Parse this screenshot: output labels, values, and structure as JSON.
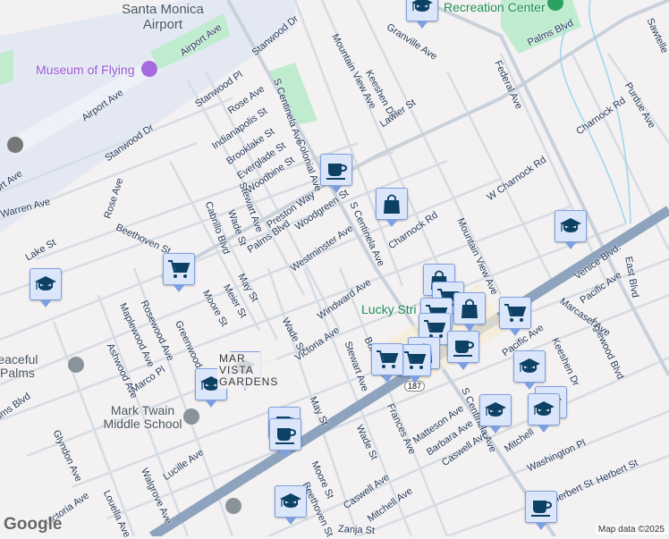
{
  "pois": {
    "airport": "Santa Monica Airport",
    "museum": "Museum of Flying",
    "recreation": "Recreation Center",
    "peaceful_palms": "Peaceful Palms Training Center",
    "mark_twain": "Mark Twain Middle School",
    "lucky_strike": "Lucky Stri",
    "mar_vista": "MAR VISTA GARDENS"
  },
  "streets": [
    "Airport Ave",
    "Airport Ave",
    "ort Ave",
    "Stanwood Dr",
    "Stanwood Pl",
    "Rose Ave",
    "Indianapolis St",
    "Brooklake St",
    "Everglade St",
    "Woodbine St",
    "Preston Way",
    "Stanwood Dr",
    "Warren Ave",
    "Rose Ave",
    "Beethoven St",
    "Lake St",
    "Cabrillo Blvd",
    "Wade St",
    "Stewart Ave",
    "Colonial Ave",
    "S Centinela Ave",
    "Palms Blvd",
    "Woodgreen St",
    "Westminster Ave",
    "Granville Ave",
    "Mountain View Ave",
    "Keeshen Dr",
    "Lawler St",
    "Federal Ave",
    "Palms Blvd",
    "Charnock Rd",
    "Purdue Ave",
    "W Charnock Rd",
    "Charnock Rd",
    "S Centinela Ave",
    "Mountain View Ave",
    "Venice Blvd.",
    "Inglewood Blvd",
    "Pacific Ave",
    "East Blvd",
    "Marcasel Ave",
    "Windward Ave",
    "Moore St",
    "Meier St",
    "May St",
    "Wade St",
    "Victoria Ave",
    "Stewart Ave",
    "Maplewood Ave",
    "Rosewood Ave",
    "Greenwood Ave",
    "Ashwood Ave",
    "Marco Pl",
    "Lucille Ave",
    "Walgrove Ave",
    "Glyndon Ave",
    "Victoria Ave",
    "Louella Ave",
    "May St",
    "Moore St",
    "Beethoven St",
    "Frances Ave",
    "Wade St",
    "Matteson Ave",
    "Barbara Ave",
    "Caswell Ave",
    "Caswell Ave",
    "Mitchell Ave",
    "Zanja St",
    "Washington Pl",
    "Herbert St",
    "Herbert St",
    "Keeshen Dr",
    "S Centinela Ave",
    "Sawtelle",
    "Palms Blvd",
    "Bolsa Ave",
    "Pacific Ave",
    "Mitchell"
  ],
  "route_shield": "187",
  "markers": [
    {
      "type": "school"
    },
    {
      "type": "cafe"
    },
    {
      "type": "shopping"
    },
    {
      "type": "school"
    },
    {
      "type": "grocery"
    },
    {
      "type": "school"
    },
    {
      "type": "school"
    },
    {
      "type": "school"
    },
    {
      "type": "cafe"
    },
    {
      "type": "cafe"
    },
    {
      "type": "school"
    },
    {
      "type": "shopping"
    },
    {
      "type": "grocery"
    },
    {
      "type": "grocery"
    },
    {
      "type": "shopping"
    },
    {
      "type": "grocery"
    },
    {
      "type": "grocery"
    },
    {
      "type": "cafe"
    },
    {
      "type": "shopping"
    },
    {
      "type": "grocery"
    },
    {
      "type": "grocery"
    },
    {
      "type": "school"
    },
    {
      "type": "school"
    },
    {
      "type": "school"
    },
    {
      "type": "school"
    },
    {
      "type": "cafe"
    }
  ],
  "footer": {
    "logo": "Google",
    "attribution": "Map data ©2025"
  },
  "colors": {
    "marker_icon": "#0d4164",
    "marker_bg": "#dbe6fb",
    "park": "#bfeccf",
    "highway": "#8ea3bd",
    "airport": "#e3e8f3"
  }
}
